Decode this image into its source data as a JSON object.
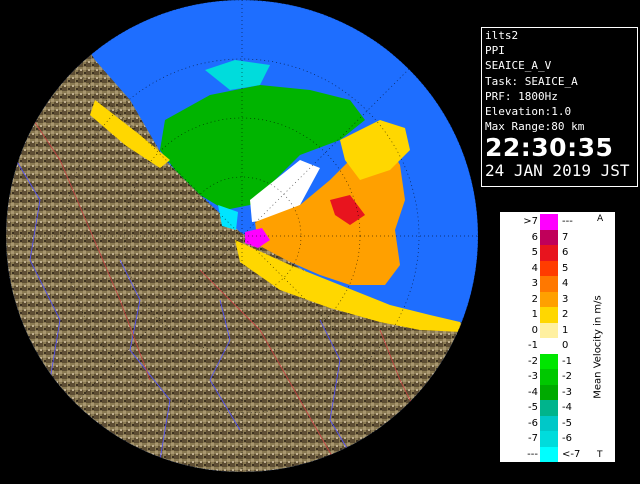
{
  "info": {
    "station": "ilts2",
    "product": "PPI",
    "scan_name": "SEAICE_A_V",
    "task": "Task: SEAICE_A",
    "prf": "PRF: 1800Hz",
    "elevation": "Elevation:1.0",
    "max_range": "Max Range:80 km",
    "time": "22:30:35",
    "date": "24 JAN 2019 JST"
  },
  "legend": {
    "title": "Mean Velocity in m/s",
    "corner_top": "A",
    "corner_bottom": "T",
    "rows": [
      {
        "lo": ">7",
        "hi": "---",
        "color": "#ff00ff"
      },
      {
        "lo": "6",
        "hi": "7",
        "color": "#c0005a"
      },
      {
        "lo": "5",
        "hi": "6",
        "color": "#e8141e"
      },
      {
        "lo": "4",
        "hi": "5",
        "color": "#ff3c00"
      },
      {
        "lo": "3",
        "hi": "4",
        "color": "#ff7800"
      },
      {
        "lo": "2",
        "hi": "3",
        "color": "#ffa000"
      },
      {
        "lo": "1",
        "hi": "2",
        "color": "#ffd700"
      },
      {
        "lo": "0",
        "hi": "1",
        "color": "#fff0a0"
      },
      {
        "lo": "-1",
        "hi": "0",
        "color": "#ffffff"
      },
      {
        "lo": "-2",
        "hi": "-1",
        "color": "#00e600"
      },
      {
        "lo": "-3",
        "hi": "-2",
        "color": "#00c800"
      },
      {
        "lo": "-4",
        "hi": "-3",
        "color": "#00aa00"
      },
      {
        "lo": "-5",
        "hi": "-4",
        "color": "#00b48c"
      },
      {
        "lo": "-6",
        "hi": "-5",
        "color": "#00c8c8"
      },
      {
        "lo": "-7",
        "hi": "-6",
        "color": "#00dcdc"
      },
      {
        "lo": "---",
        "hi": "<-7",
        "color": "#00ffff"
      }
    ]
  },
  "colors": {
    "background": "#000000",
    "coverage": "#1e6eff",
    "land": "#8c7a50",
    "rivers": "#5050ff",
    "boundaries": "#c84040"
  }
}
